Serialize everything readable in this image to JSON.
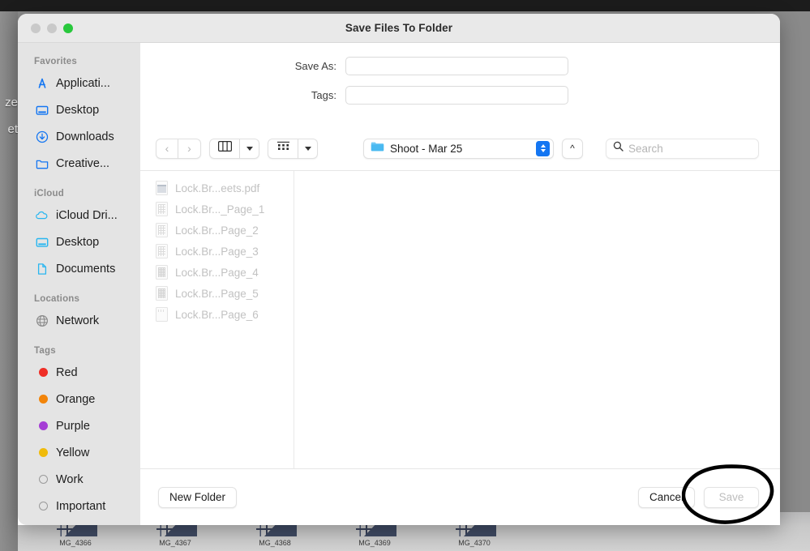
{
  "window": {
    "title": "Save Files To Folder",
    "traffic_lights": [
      "close",
      "minimize",
      "zoom"
    ]
  },
  "background": {
    "left_fragments": [
      "ze",
      "et"
    ],
    "photos": [
      {
        "label": "MG_4366"
      },
      {
        "label": "MG_4367"
      },
      {
        "label": "MG_4368"
      },
      {
        "label": "MG_4369"
      },
      {
        "label": "MG_4370"
      }
    ]
  },
  "form": {
    "save_as": {
      "label": "Save As:",
      "value": "",
      "placeholder": ""
    },
    "tags": {
      "label": "Tags:",
      "value": "",
      "placeholder": ""
    }
  },
  "toolbar": {
    "back_icon": "chevron-left-icon",
    "forward_icon": "chevron-right-icon",
    "view_column_icon": "column-view-icon",
    "view_icon_grid_icon": "icon-view-icon",
    "path": "Shoot - Mar 25",
    "folder_icon": "folder-icon",
    "stepper_icon": "up-down-stepper-icon",
    "up_icon": "chevron-up-icon",
    "search": {
      "placeholder": "Search",
      "value": "",
      "icon": "search-icon"
    }
  },
  "sidebar": {
    "groups": [
      {
        "title": "Favorites",
        "items": [
          {
            "label": "Applicati...",
            "icon": "applications-icon"
          },
          {
            "label": "Desktop",
            "icon": "desktop-icon"
          },
          {
            "label": "Downloads",
            "icon": "downloads-icon"
          },
          {
            "label": "Creative...",
            "icon": "folder-icon"
          }
        ]
      },
      {
        "title": "iCloud",
        "items": [
          {
            "label": "iCloud Dri...",
            "icon": "cloud-icon"
          },
          {
            "label": "Desktop",
            "icon": "desktop-icon"
          },
          {
            "label": "Documents",
            "icon": "document-icon"
          }
        ]
      },
      {
        "title": "Locations",
        "items": [
          {
            "label": "Network",
            "icon": "globe-icon"
          }
        ]
      },
      {
        "title": "Tags",
        "items": [
          {
            "label": "Red",
            "icon": "tag-dot-icon",
            "color": "#ef2e26"
          },
          {
            "label": "Orange",
            "icon": "tag-dot-icon",
            "color": "#f28409"
          },
          {
            "label": "Purple",
            "icon": "tag-dot-icon",
            "color": "#a53ed5"
          },
          {
            "label": "Yellow",
            "icon": "tag-dot-icon",
            "color": "#f0bb0b"
          },
          {
            "label": "Work",
            "icon": "tag-dot-hollow-icon",
            "color": ""
          },
          {
            "label": "Important",
            "icon": "tag-dot-hollow-icon",
            "color": ""
          }
        ]
      }
    ]
  },
  "file_list": [
    {
      "name": "Lock.Br...eets.pdf",
      "icon": "pdf-file-icon",
      "disabled": true
    },
    {
      "name": "Lock.Br..._Page_1",
      "icon": "sheet-file-icon",
      "disabled": true
    },
    {
      "name": "Lock.Br...Page_2",
      "icon": "sheet-file-icon",
      "disabled": true
    },
    {
      "name": "Lock.Br...Page_3",
      "icon": "sheet-file-icon",
      "disabled": true
    },
    {
      "name": "Lock.Br...Page_4",
      "icon": "sheet-dense-file-icon",
      "disabled": true
    },
    {
      "name": "Lock.Br...Page_5",
      "icon": "sheet-dense-file-icon",
      "disabled": true
    },
    {
      "name": "Lock.Br...Page_6",
      "icon": "blank-file-icon",
      "disabled": true
    }
  ],
  "footer": {
    "new_folder_label": "New Folder",
    "cancel_label": "Cancel",
    "save_label": "Save",
    "save_disabled": true
  },
  "annotation": {
    "type": "hand-drawn-ellipse",
    "target": "save-button",
    "color": "#000000"
  },
  "colors": {
    "accent": "#1476f2",
    "sidebar_bg": "#e4e4e4",
    "titlebar_bg": "#e9e9e9",
    "desktop_bg": "#8a8a8a"
  }
}
